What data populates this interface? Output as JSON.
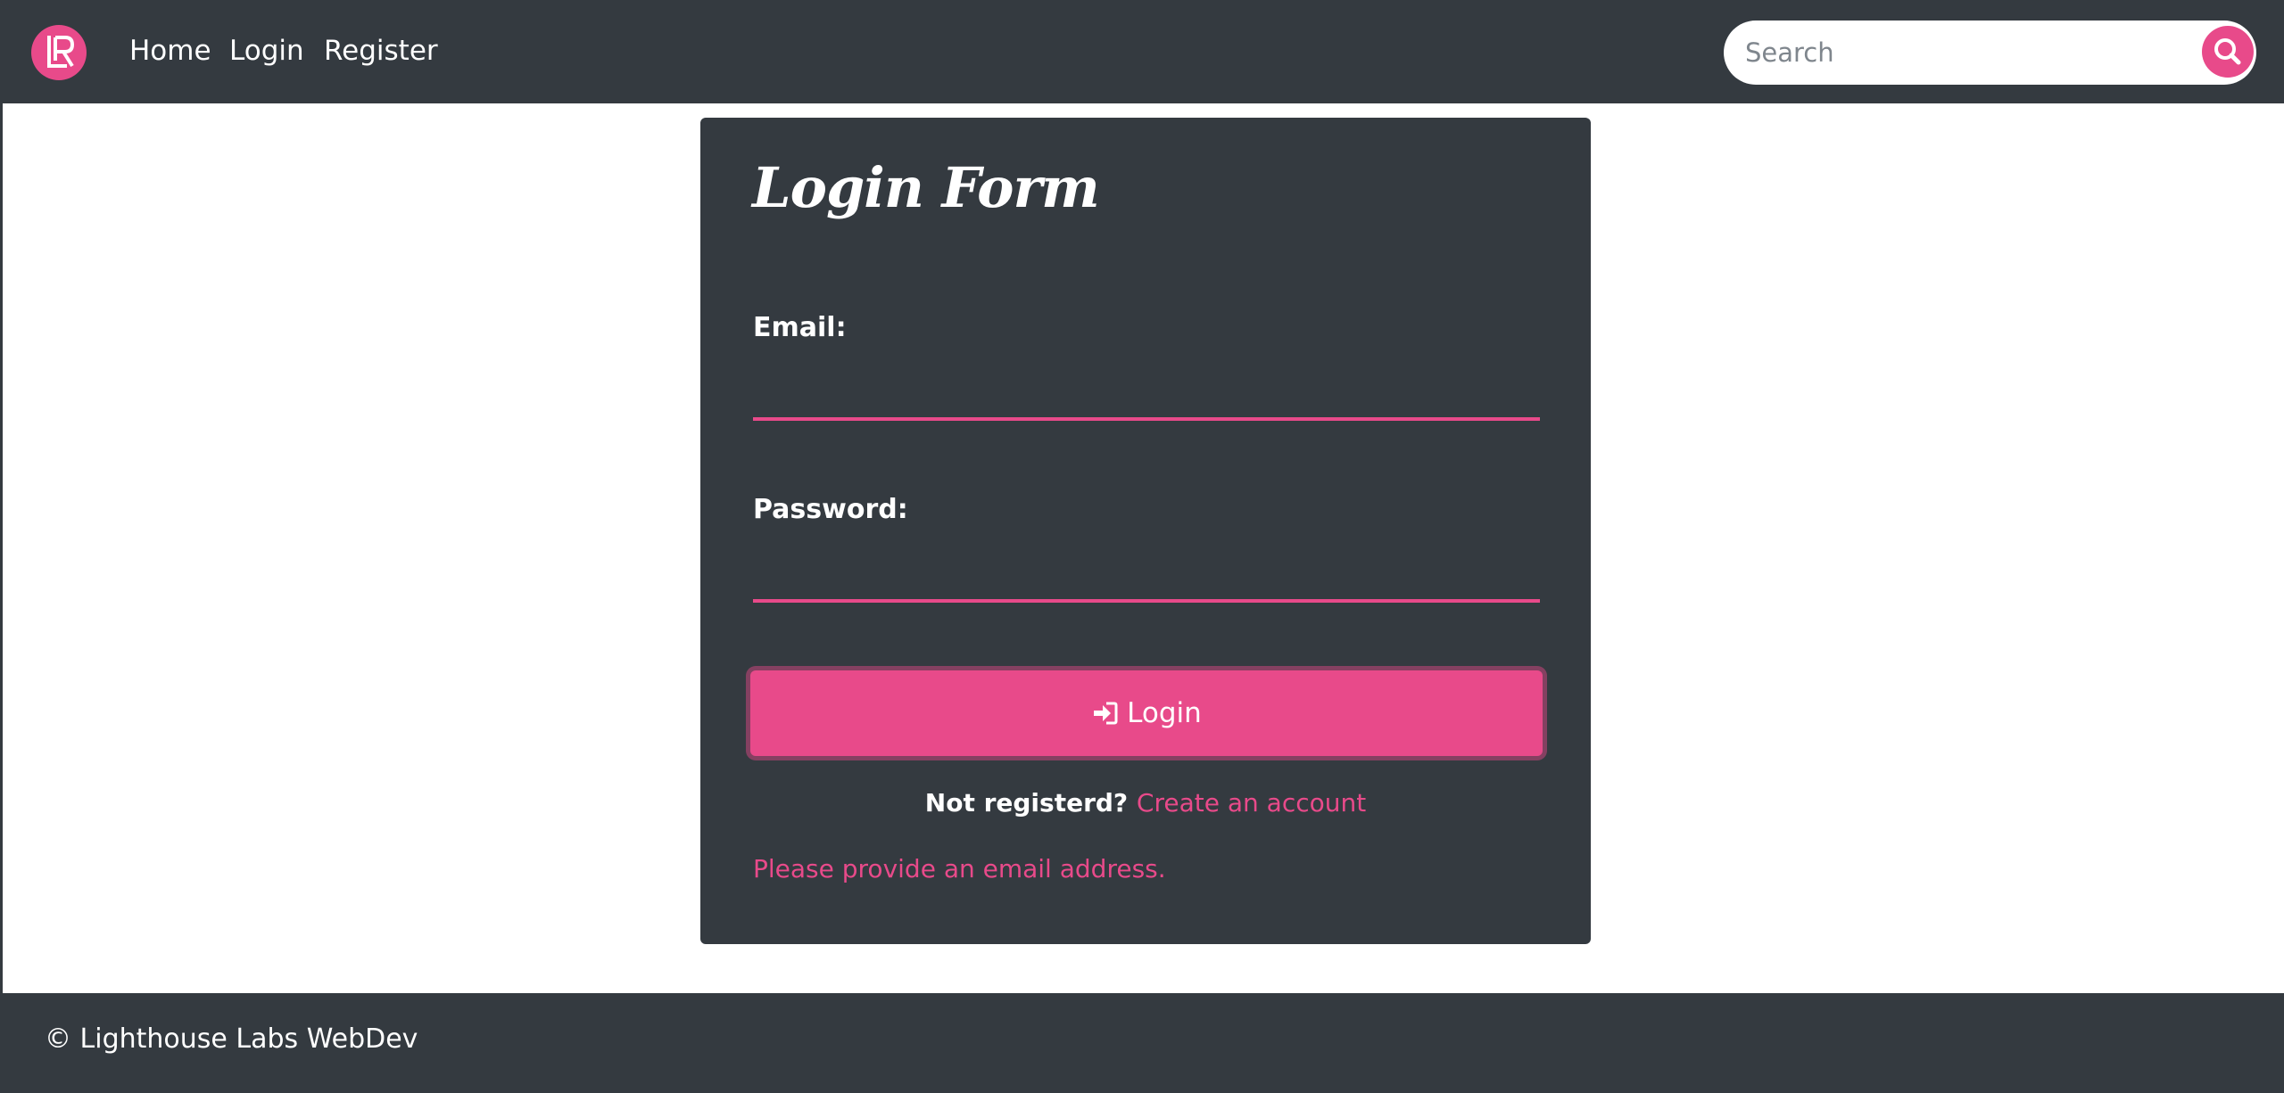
{
  "navbar": {
    "logo_text": "LR",
    "links": [
      "Home",
      "Login",
      "Register"
    ],
    "search": {
      "placeholder": "Search"
    }
  },
  "login_form": {
    "title": "Login Form",
    "email_label": "Email:",
    "email_value": "",
    "password_label": "Password:",
    "password_value": "",
    "submit_label": "Login",
    "register_prompt": "Not registerd?",
    "register_link": "Create an account",
    "error_message": "Please provide an email address."
  },
  "footer": {
    "copyright": "© Lighthouse Labs WebDev"
  },
  "colors": {
    "accent": "#e84a8a",
    "dark": "#343a40",
    "background": "#ffffff"
  },
  "icons": [
    "logo",
    "search-icon",
    "sign-in-icon"
  ]
}
